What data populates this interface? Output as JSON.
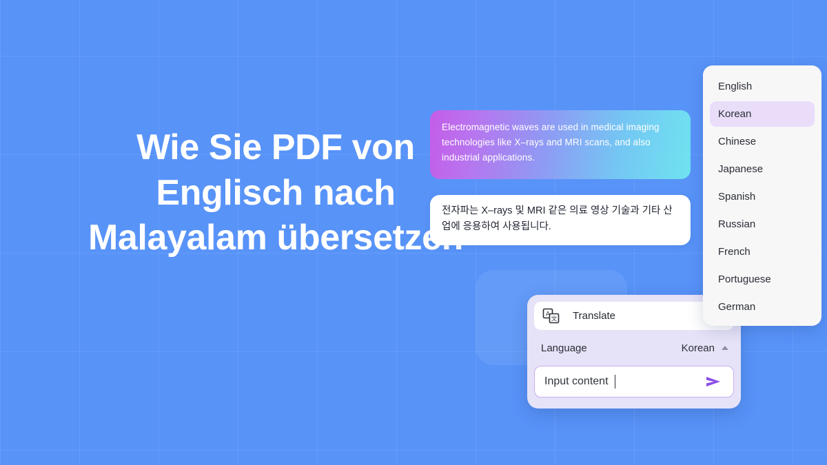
{
  "background": {
    "color": "#5893f8",
    "grid": true
  },
  "headline": {
    "text": "Wie Sie PDF von Englisch nach Malayalam übersetzen"
  },
  "source_bubble": {
    "text": "Electromagnetic waves are used in medical imaging technologies like X–rays and MRI scans, and also industrial applications.",
    "gradient_from": "#c45ce8",
    "gradient_to": "#6fe3f0"
  },
  "target_bubble": {
    "text": "전자파는 X–rays 및 MRI 같은 의료 영상 기술과 기타 산업에 응용하여 사용됩니다."
  },
  "language_menu": {
    "selected": "Korean",
    "highlight_color": "#e9ddfa",
    "items": [
      {
        "label": "English"
      },
      {
        "label": "Korean"
      },
      {
        "label": "Chinese"
      },
      {
        "label": "Japanese"
      },
      {
        "label": "Spanish"
      },
      {
        "label": "Russian"
      },
      {
        "label": "French"
      },
      {
        "label": "Portuguese"
      },
      {
        "label": "German"
      }
    ]
  },
  "translate_panel": {
    "title": "Translate",
    "title_icon": "translate-icon",
    "language_label": "Language",
    "language_value": "Korean",
    "chevron_icon": "chevron-up-icon",
    "input_placeholder": "Input content",
    "input_value": "",
    "send_icon": "send-icon",
    "send_color": "#8b4dea",
    "panel_color": "#e6e2f7"
  }
}
